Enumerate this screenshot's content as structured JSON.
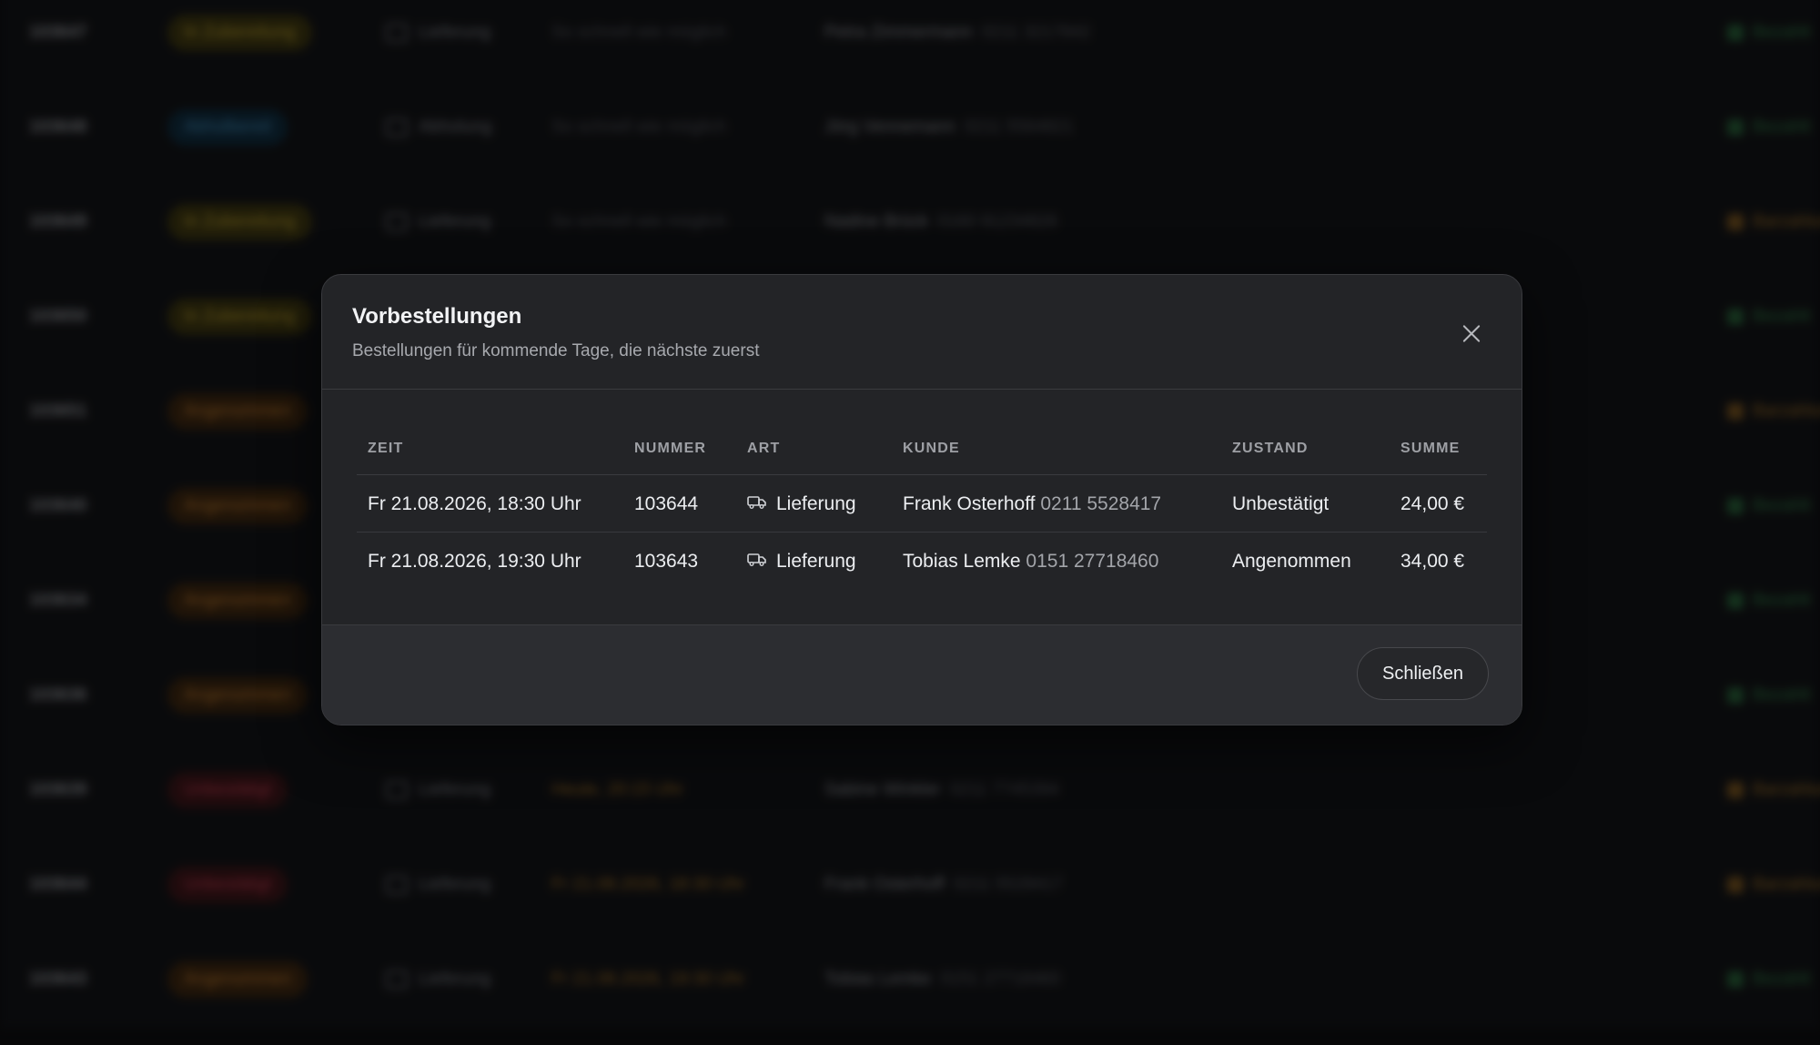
{
  "background": {
    "rows": [
      {
        "id": "103647",
        "badge": "In Zubereitung",
        "badge_color": "yellow",
        "type": "Lieferung",
        "time": "So schnell wie möglich",
        "time_color": "grey",
        "customer": "Petra Zimmermann",
        "phone": "0211 3217842",
        "right": "Bezahlt",
        "right_color": "green"
      },
      {
        "id": "103648",
        "badge": "Abholbereit",
        "badge_color": "blue",
        "type": "Abholung",
        "time": "So schnell wie möglich",
        "time_color": "grey",
        "customer": "Jörg Vennemann",
        "phone": "0211 5564821",
        "right": "Bezahlt",
        "right_color": "green"
      },
      {
        "id": "103649",
        "badge": "In Zubereitung",
        "badge_color": "yellow",
        "type": "Lieferung",
        "time": "So schnell wie möglich",
        "time_color": "grey",
        "customer": "Nadine Brück",
        "phone": "0160 91234826",
        "right": "Barzahlung",
        "right_color": "orange"
      },
      {
        "id": "103650",
        "badge": "In Zubereitung",
        "badge_color": "yellow",
        "type": "",
        "time": "",
        "time_color": "grey",
        "customer": "",
        "phone": "",
        "right": "Bezahlt",
        "right_color": "green"
      },
      {
        "id": "103651",
        "badge": "Angenommen",
        "badge_color": "orange",
        "type": "",
        "time": "",
        "time_color": "grey",
        "customer": "",
        "phone": "",
        "right": "Barzahlung",
        "right_color": "orange"
      },
      {
        "id": "103640",
        "badge": "Angenommen",
        "badge_color": "orange",
        "type": "",
        "time": "",
        "time_color": "grey",
        "customer": "",
        "phone": "",
        "right": "Bezahlt",
        "right_color": "green"
      },
      {
        "id": "103634",
        "badge": "Angenommen",
        "badge_color": "orange",
        "type": "",
        "time": "",
        "time_color": "grey",
        "customer": "",
        "phone": "",
        "right": "Bezahlt",
        "right_color": "green"
      },
      {
        "id": "103636",
        "badge": "Angenommen",
        "badge_color": "orange",
        "type": "",
        "time": "",
        "time_color": "grey",
        "customer": "",
        "phone": "",
        "right": "Bezahlt",
        "right_color": "green"
      },
      {
        "id": "103639",
        "badge": "Unbestätigt",
        "badge_color": "red",
        "type": "Lieferung",
        "time": "Heute, 20:15 Uhr",
        "time_color": "orange",
        "customer": "Sabine Winkler",
        "phone": "0211 7745394",
        "right": "Barzahlung",
        "right_color": "orange"
      },
      {
        "id": "103644",
        "badge": "Unbestätigt",
        "badge_color": "red",
        "type": "Lieferung",
        "time": "Fr 21.08.2026, 18:30 Uhr",
        "time_color": "orange",
        "customer": "Frank Osterhoff",
        "phone": "0211 5528417",
        "right": "Barzahlung",
        "right_color": "orange"
      },
      {
        "id": "103643",
        "badge": "Angenommen",
        "badge_color": "orange",
        "type": "Lieferung",
        "time": "Fr 21.08.2026, 19:30 Uhr",
        "time_color": "orange",
        "customer": "Tobias Lemke",
        "phone": "0151 27718460",
        "right": "Bezahlt",
        "right_color": "green"
      }
    ]
  },
  "modal": {
    "title": "Vorbestellungen",
    "subtitle": "Bestellungen für kommende Tage, die nächste zuerst",
    "close_icon": "close-icon",
    "columns": [
      "ZEIT",
      "NUMMER",
      "ART",
      "KUNDE",
      "ZUSTAND",
      "SUMME"
    ],
    "rows": [
      {
        "time": "Fr 21.08.2026, 18:30 Uhr",
        "number": "103644",
        "type_icon": "truck-icon",
        "type": "Lieferung",
        "customer": "Frank Osterhoff",
        "phone": "0211 5528417",
        "status": "Unbestätigt",
        "sum": "24,00 €"
      },
      {
        "time": "Fr 21.08.2026, 19:30 Uhr",
        "number": "103643",
        "type_icon": "truck-icon",
        "type": "Lieferung",
        "customer": "Tobias Lemke",
        "phone": "0151 27718460",
        "status": "Angenommen",
        "sum": "34,00 €"
      }
    ],
    "close_label": "Schließen"
  },
  "colors": {
    "accent_green": "#2f7a45",
    "accent_orange": "#9a6a24",
    "modal_bg": "#232427"
  }
}
